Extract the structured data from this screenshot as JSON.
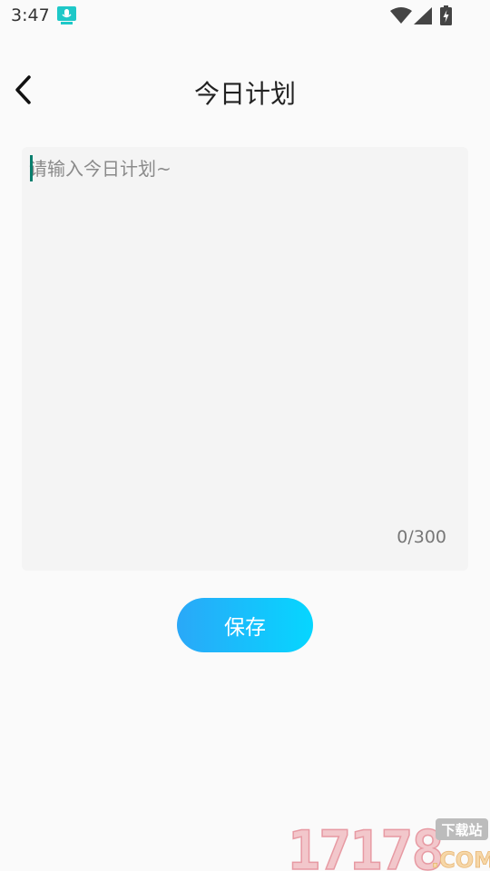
{
  "status_bar": {
    "time": "3:47",
    "icons": [
      "notification-icon",
      "wifi-icon",
      "signal-icon",
      "battery-charging-icon"
    ]
  },
  "app_bar": {
    "back_icon": "chevron-left-icon",
    "title": "今日计划"
  },
  "editor": {
    "placeholder": "请输入今日计划~",
    "value": "",
    "char_count": "0/300"
  },
  "actions": {
    "save_label": "保存"
  },
  "watermark": {
    "logo_text": "17178",
    "tag": "下载站",
    "domain": ".COM"
  },
  "colors": {
    "background": "#fafafa",
    "input_background": "#f4f4f4",
    "button_gradient_start": "#2aa8f8",
    "button_gradient_end": "#06d6ff",
    "caret": "#0a7f6e"
  }
}
